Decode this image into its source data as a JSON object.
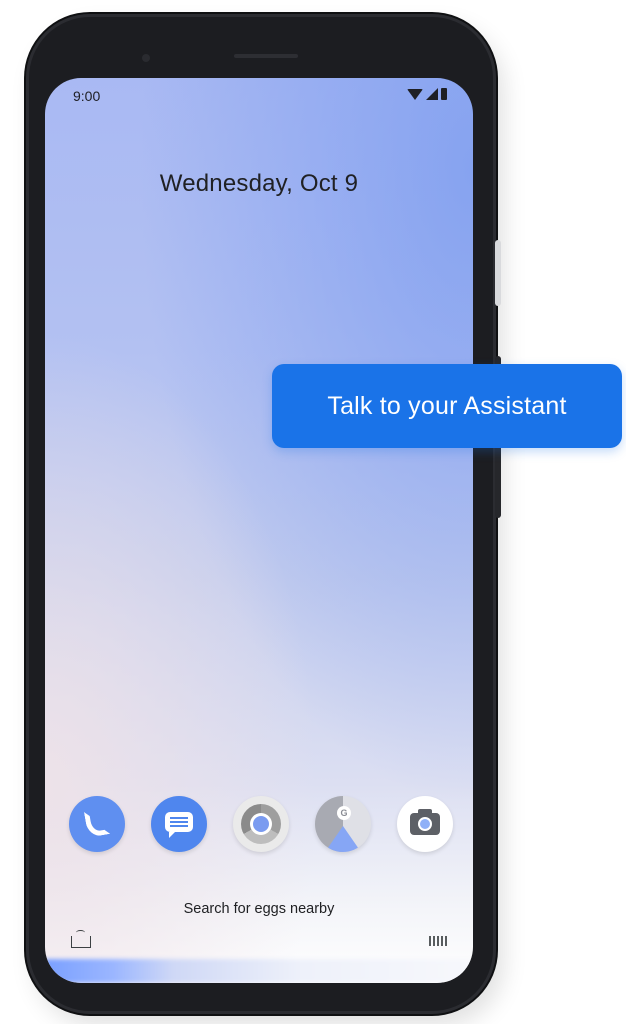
{
  "status_bar": {
    "time": "9:00",
    "icons": [
      "wifi-icon",
      "signal-icon",
      "battery-icon"
    ]
  },
  "lock_screen": {
    "date": "Wednesday, Oct 9"
  },
  "dock": {
    "apps": [
      {
        "icon": "phone-icon"
      },
      {
        "icon": "messages-icon"
      },
      {
        "icon": "chrome-icon"
      },
      {
        "icon": "maps-icon"
      },
      {
        "icon": "camera-icon"
      }
    ]
  },
  "assistant": {
    "search_prompt": "Search for eggs nearby",
    "callout": "Talk to your Assistant",
    "left_icon": "lens-icon",
    "right_icon": "keyboard-icon"
  },
  "colors": {
    "accent": "#1a73e8",
    "phone_frame": "#1c1d21"
  }
}
